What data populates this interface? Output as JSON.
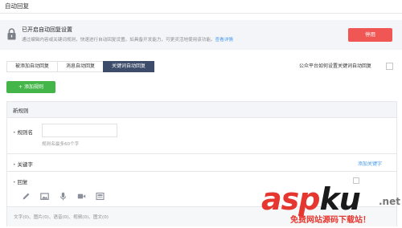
{
  "header": {
    "title": "自动回复"
  },
  "notice": {
    "title": "已开启自动回复设置",
    "desc": "通过编辑内容或关键词规则，快速进行自动回复设置。如具备开发能力，可更灵活地使用该功能。",
    "link": "查看详情",
    "stop_label": "停用"
  },
  "tabs": [
    {
      "label": "被添加自动回复",
      "active": false
    },
    {
      "label": "消息自动回复",
      "active": false
    },
    {
      "label": "关键词自动回复",
      "active": true
    }
  ],
  "help": {
    "label": "公众平台如何设置关键词自动回复"
  },
  "add_rule_label": "添加规则",
  "panel": {
    "title": "新规则",
    "rule_name_label": "规则名",
    "rule_name_value": "",
    "rule_name_hint": "规则名最多60个字",
    "keyword_label": "关键字",
    "add_keyword_label": "添加关键字",
    "reply_label": "回复",
    "toolbar": [
      "pencil-icon",
      "image-icon",
      "microphone-icon",
      "video-icon",
      "news-icon"
    ],
    "reply_summary": "文字(0)、图片(0)、语音(0)、视频(0)、图文(0)"
  },
  "watermark": {
    "brand_1": "asp",
    "brand_2": "ku",
    "brand_3": "",
    "brand_net": ".net",
    "slogan": "免费网站源码下载站！"
  },
  "colors": {
    "accent_green": "#44b549",
    "danger_red": "#f05754",
    "tab_active": "#3c4c6a",
    "link_blue": "#459ae9"
  }
}
